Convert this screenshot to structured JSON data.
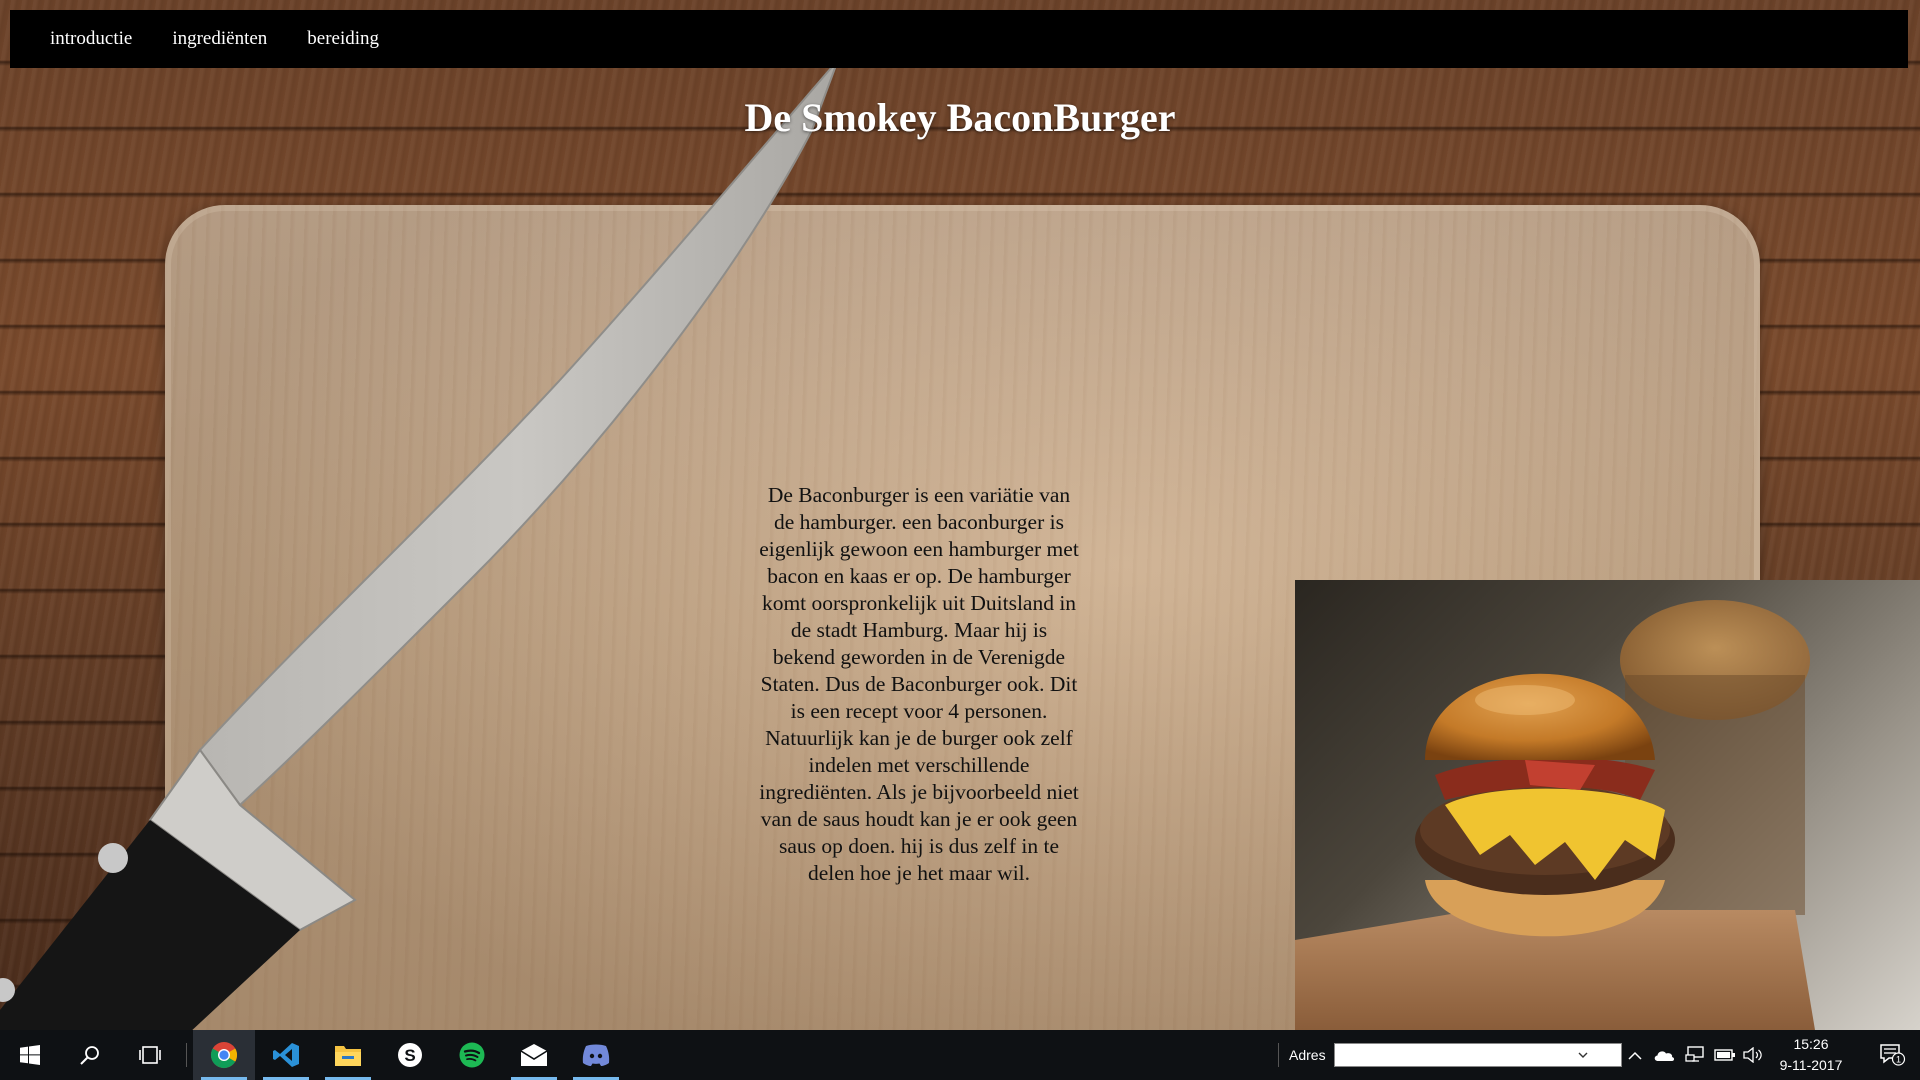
{
  "nav": {
    "items": [
      {
        "label": "introductie"
      },
      {
        "label": "ingrediënten"
      },
      {
        "label": "bereiding"
      }
    ]
  },
  "page": {
    "title": "De Smokey BaconBurger",
    "intro": "De Baconburger is een variätie van de hamburger. een baconburger is eigenlijk gewoon een hamburger met bacon en kaas er op. De hamburger komt oorspronkelijk uit Duitsland in de stadt Hamburg. Maar hij is bekend geworden in de Verenigde Staten. Dus de Baconburger ook. Dit is een recept voor 4 personen. Natuurlijk kan je de burger ook zelf indelen met verschillende ingrediënten. Als je bijvoorbeeld niet van de saus houdt kan je er ook geen saus op doen. hij is dus zelf in te delen hoe je het maar wil."
  },
  "taskbar": {
    "apps": [
      {
        "icon": "chrome-icon",
        "active": true
      },
      {
        "icon": "vscode-icon",
        "active": false
      },
      {
        "icon": "file-explorer-icon",
        "active": false
      },
      {
        "icon": "skype-icon",
        "active": false
      },
      {
        "icon": "spotify-icon",
        "active": false
      },
      {
        "icon": "mail-icon",
        "active": false
      },
      {
        "icon": "discord-icon",
        "active": false
      }
    ],
    "address_label": "Adres",
    "address_value": "",
    "time": "15:26",
    "date": "9-11-2017",
    "notification_count": "1"
  },
  "colors": {
    "nav_bg": "#000000",
    "taskbar_bg": "#0e1114",
    "accent": "#76b9ed"
  }
}
